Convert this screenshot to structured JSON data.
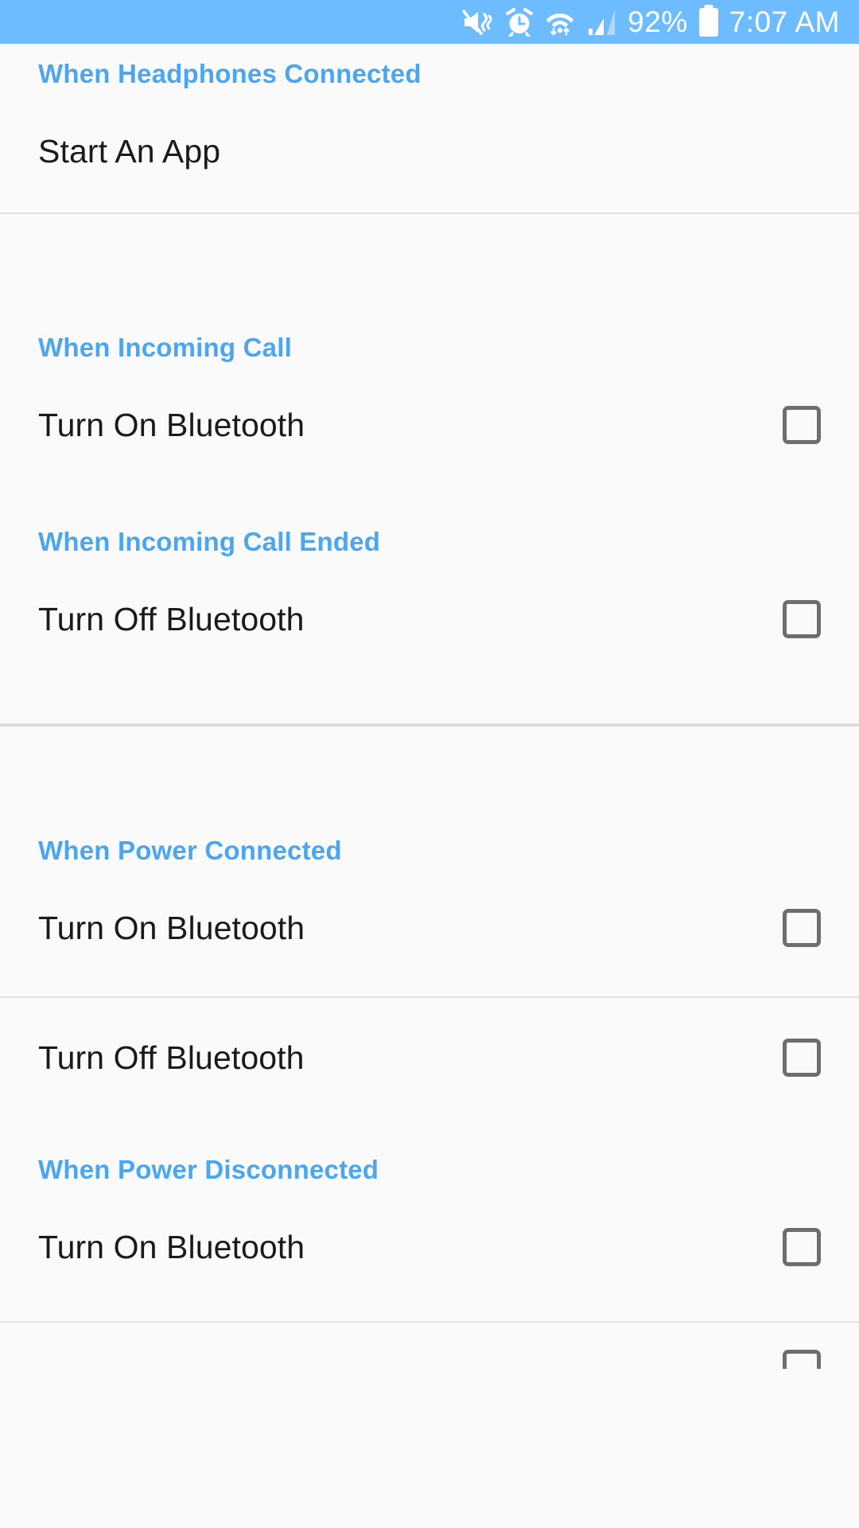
{
  "status_bar": {
    "background_color": "#6CBCFF",
    "text_color": "#FFFFFF",
    "battery_percent": "92%",
    "time": "7:07 AM",
    "icons": [
      "mute-vibrate-icon",
      "alarm-clock-icon",
      "wifi-data-transfer-icon",
      "cellular-signal-icon",
      "battery-icon"
    ]
  },
  "theme": {
    "accent_color": "#4BA6F0",
    "page_background": "#FAFAFA",
    "label_color": "#1A1A1A",
    "checkbox_border_color": "#6E6E6E",
    "divider_color": "#E2E2E2"
  },
  "sections": [
    {
      "header": "When Headphones Connected",
      "rows": [
        {
          "label": "Start An App",
          "has_checkbox": false,
          "checked": false
        }
      ]
    },
    {
      "header": "When Incoming Call",
      "rows": [
        {
          "label": "Turn On Bluetooth",
          "has_checkbox": true,
          "checked": false
        }
      ]
    },
    {
      "header": "When Incoming Call Ended",
      "rows": [
        {
          "label": "Turn Off Bluetooth",
          "has_checkbox": true,
          "checked": false
        }
      ]
    },
    {
      "header": "When Power Connected",
      "rows": [
        {
          "label": "Turn On Bluetooth",
          "has_checkbox": true,
          "checked": false
        },
        {
          "label": "Turn Off Bluetooth",
          "has_checkbox": true,
          "checked": false
        }
      ]
    },
    {
      "header": "When Power Disconnected",
      "rows": [
        {
          "label": "Turn On Bluetooth",
          "has_checkbox": true,
          "checked": false
        }
      ]
    }
  ]
}
